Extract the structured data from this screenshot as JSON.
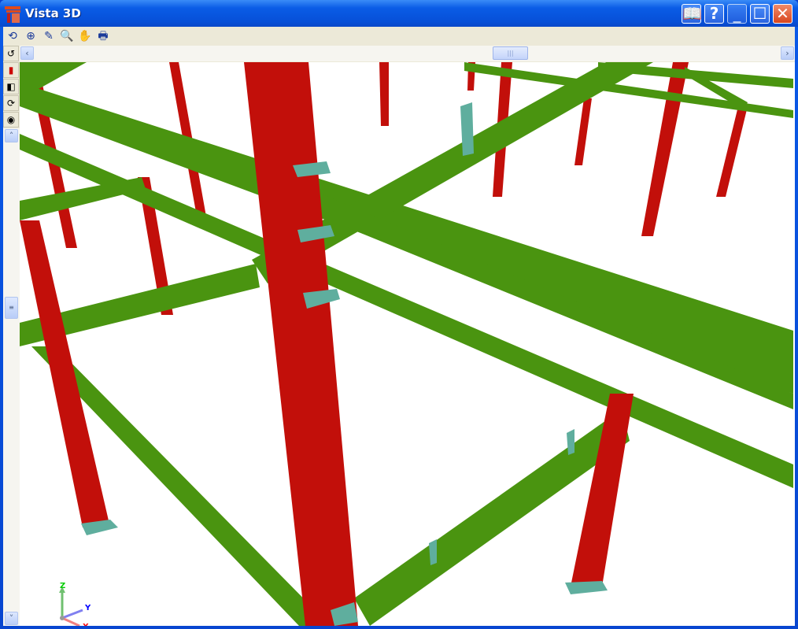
{
  "window": {
    "title": "Vista 3D",
    "buttons": [
      "help-book",
      "?",
      "minimize",
      "maximize",
      "close"
    ]
  },
  "toolbar": {
    "tools": [
      "rotate-view-icon",
      "zoom-extents-icon",
      "draw-icon",
      "zoom-window-icon",
      "pan-hand-icon",
      "print-icon"
    ]
  },
  "sidebar": {
    "tools": [
      "undo-rotate-icon",
      "chart-icon",
      "box-view-icon",
      "orbit-icon",
      "render-settings-icon"
    ]
  },
  "axes": {
    "z": "Z",
    "y": "Y",
    "x": "X"
  },
  "colors": {
    "column": "#c20f0a",
    "beam": "#4a9410",
    "plate": "#5fae9e"
  }
}
